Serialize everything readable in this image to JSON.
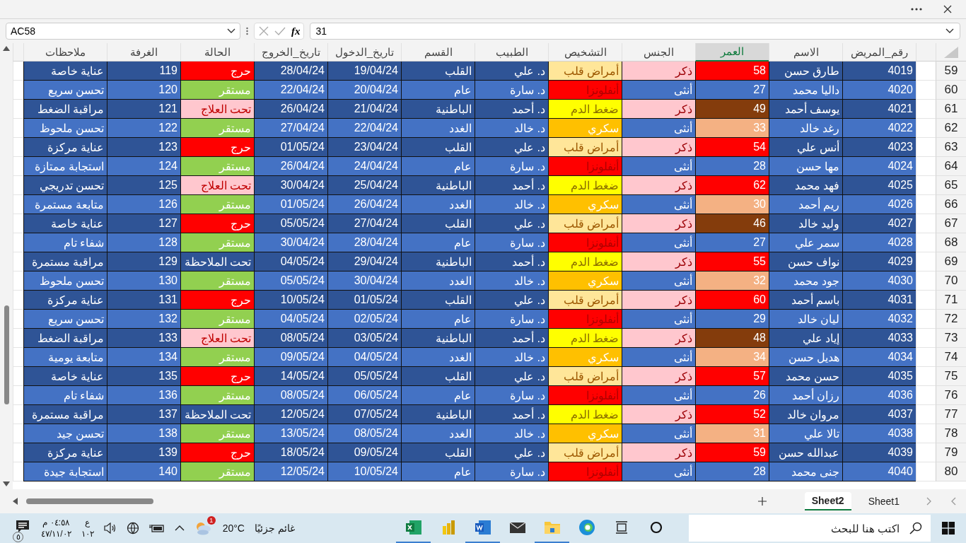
{
  "formula_bar": {
    "name_box": "AC58",
    "function_label": "fx",
    "formula": "31"
  },
  "sheet": {
    "columns": [
      {
        "label": "رقم_المريض",
        "selected": false
      },
      {
        "label": "الاسم",
        "selected": false
      },
      {
        "label": "العمر",
        "selected": true
      },
      {
        "label": "الجنس",
        "selected": false
      },
      {
        "label": "التشخيص",
        "selected": false
      },
      {
        "label": "الطبيب",
        "selected": false
      },
      {
        "label": "القسم",
        "selected": false
      },
      {
        "label": "تاريخ_الدخول",
        "selected": false
      },
      {
        "label": "تاريخ_الخروج",
        "selected": false
      },
      {
        "label": "الحالة",
        "selected": false
      },
      {
        "label": "الغرفة",
        "selected": false
      },
      {
        "label": "ملاحظات",
        "selected": false
      }
    ],
    "rows": [
      {
        "row": "59",
        "cells": [
          "4019",
          "طارق حسن",
          {
            "text": "58",
            "kind": "red"
          },
          {
            "text": "ذكر",
            "kind": "male"
          },
          {
            "text": "أمراض قلب",
            "kind": "heart"
          },
          "د. علي",
          "القلب",
          "19/04/24",
          "28/04/24",
          {
            "text": "حرج",
            "kind": "critical"
          },
          "119",
          "عناية خاصة"
        ]
      },
      {
        "row": "60",
        "cells": [
          "4020",
          "داليا محمد",
          {
            "text": "27",
            "kind": "plain"
          },
          {
            "text": "أنثى",
            "kind": "female"
          },
          {
            "text": "أنفلونزا",
            "kind": "flu"
          },
          "د. سارة",
          "عام",
          "20/04/24",
          "22/04/24",
          {
            "text": "مستقر",
            "kind": "stable"
          },
          "120",
          "تحسن سريع"
        ]
      },
      {
        "row": "61",
        "cells": [
          "4021",
          "يوسف أحمد",
          {
            "text": "49",
            "kind": "brown"
          },
          {
            "text": "ذكر",
            "kind": "male"
          },
          {
            "text": "ضغط الدم",
            "kind": "pressure"
          },
          "د. أحمد",
          "الباطنية",
          "21/04/24",
          "26/04/24",
          {
            "text": "تحت العلاج",
            "kind": "treatment"
          },
          "121",
          "مراقبة الضغط"
        ]
      },
      {
        "row": "62",
        "cells": [
          "4022",
          "رغد خالد",
          {
            "text": "33",
            "kind": "salmon"
          },
          {
            "text": "أنثى",
            "kind": "female"
          },
          {
            "text": "سكري",
            "kind": "diabetes"
          },
          "د. خالد",
          "الغدد",
          "22/04/24",
          "27/04/24",
          {
            "text": "مستقر",
            "kind": "stable"
          },
          "122",
          "تحسن ملحوظ"
        ]
      },
      {
        "row": "63",
        "cells": [
          "4023",
          "أنس علي",
          {
            "text": "54",
            "kind": "red"
          },
          {
            "text": "ذكر",
            "kind": "male"
          },
          {
            "text": "أمراض قلب",
            "kind": "heart"
          },
          "د. علي",
          "القلب",
          "23/04/24",
          "01/05/24",
          {
            "text": "حرج",
            "kind": "critical"
          },
          "123",
          "عناية مركزة"
        ]
      },
      {
        "row": "64",
        "cells": [
          "4024",
          "مها حسن",
          {
            "text": "28",
            "kind": "plain"
          },
          {
            "text": "أنثى",
            "kind": "female"
          },
          {
            "text": "أنفلونزا",
            "kind": "flu"
          },
          "د. سارة",
          "عام",
          "24/04/24",
          "26/04/24",
          {
            "text": "مستقر",
            "kind": "stable"
          },
          "124",
          "استجابة ممتازة"
        ]
      },
      {
        "row": "65",
        "cells": [
          "4025",
          "فهد محمد",
          {
            "text": "62",
            "kind": "red"
          },
          {
            "text": "ذكر",
            "kind": "male"
          },
          {
            "text": "ضغط الدم",
            "kind": "pressure"
          },
          "د. أحمد",
          "الباطنية",
          "25/04/24",
          "30/04/24",
          {
            "text": "تحت العلاج",
            "kind": "treatment"
          },
          "125",
          "تحسن تدريجي"
        ]
      },
      {
        "row": "66",
        "cells": [
          "4026",
          "ريم أحمد",
          {
            "text": "30",
            "kind": "salmon"
          },
          {
            "text": "أنثى",
            "kind": "female"
          },
          {
            "text": "سكري",
            "kind": "diabetes"
          },
          "د. خالد",
          "الغدد",
          "26/04/24",
          "01/05/24",
          {
            "text": "مستقر",
            "kind": "stable"
          },
          "126",
          "متابعة مستمرة"
        ]
      },
      {
        "row": "67",
        "cells": [
          "4027",
          "وليد خالد",
          {
            "text": "46",
            "kind": "brown"
          },
          {
            "text": "ذكر",
            "kind": "male"
          },
          {
            "text": "أمراض قلب",
            "kind": "heart"
          },
          "د. علي",
          "القلب",
          "27/04/24",
          "05/05/24",
          {
            "text": "حرج",
            "kind": "critical"
          },
          "127",
          "عناية خاصة"
        ]
      },
      {
        "row": "68",
        "cells": [
          "4028",
          "سمر علي",
          {
            "text": "27",
            "kind": "plain"
          },
          {
            "text": "أنثى",
            "kind": "female"
          },
          {
            "text": "أنفلونزا",
            "kind": "flu"
          },
          "د. سارة",
          "عام",
          "28/04/24",
          "30/04/24",
          {
            "text": "مستقر",
            "kind": "stable"
          },
          "128",
          "شفاء تام"
        ]
      },
      {
        "row": "69",
        "cells": [
          "4029",
          "نواف حسن",
          {
            "text": "55",
            "kind": "red"
          },
          {
            "text": "ذكر",
            "kind": "male"
          },
          {
            "text": "ضغط الدم",
            "kind": "pressure"
          },
          "د. أحمد",
          "الباطنية",
          "29/04/24",
          "04/05/24",
          {
            "text": "تحت الملاحظة",
            "kind": "observation"
          },
          "129",
          "مراقبة مستمرة"
        ]
      },
      {
        "row": "70",
        "cells": [
          "4030",
          "جود محمد",
          {
            "text": "32",
            "kind": "salmon"
          },
          {
            "text": "أنثى",
            "kind": "female"
          },
          {
            "text": "سكري",
            "kind": "diabetes"
          },
          "د. خالد",
          "الغدد",
          "30/04/24",
          "05/05/24",
          {
            "text": "مستقر",
            "kind": "stable"
          },
          "130",
          "تحسن ملحوظ"
        ]
      },
      {
        "row": "71",
        "cells": [
          "4031",
          "باسم أحمد",
          {
            "text": "60",
            "kind": "red"
          },
          {
            "text": "ذكر",
            "kind": "male"
          },
          {
            "text": "أمراض قلب",
            "kind": "heart"
          },
          "د. علي",
          "القلب",
          "01/05/24",
          "10/05/24",
          {
            "text": "حرج",
            "kind": "critical"
          },
          "131",
          "عناية مركزة"
        ]
      },
      {
        "row": "72",
        "cells": [
          "4032",
          "ليان خالد",
          {
            "text": "29",
            "kind": "plain"
          },
          {
            "text": "أنثى",
            "kind": "female"
          },
          {
            "text": "أنفلونزا",
            "kind": "flu"
          },
          "د. سارة",
          "عام",
          "02/05/24",
          "04/05/24",
          {
            "text": "مستقر",
            "kind": "stable"
          },
          "132",
          "تحسن سريع"
        ]
      },
      {
        "row": "73",
        "cells": [
          "4033",
          "إياد علي",
          {
            "text": "48",
            "kind": "brown"
          },
          {
            "text": "ذكر",
            "kind": "male"
          },
          {
            "text": "ضغط الدم",
            "kind": "pressure"
          },
          "د. أحمد",
          "الباطنية",
          "03/05/24",
          "08/05/24",
          {
            "text": "تحت العلاج",
            "kind": "treatment"
          },
          "133",
          "مراقبة الضغط"
        ]
      },
      {
        "row": "74",
        "cells": [
          "4034",
          "هديل حسن",
          {
            "text": "34",
            "kind": "salmon"
          },
          {
            "text": "أنثى",
            "kind": "female"
          },
          {
            "text": "سكري",
            "kind": "diabetes"
          },
          "د. خالد",
          "الغدد",
          "04/05/24",
          "09/05/24",
          {
            "text": "مستقر",
            "kind": "stable"
          },
          "134",
          "متابعة يومية"
        ]
      },
      {
        "row": "75",
        "cells": [
          "4035",
          "حسن محمد",
          {
            "text": "57",
            "kind": "red"
          },
          {
            "text": "ذكر",
            "kind": "male"
          },
          {
            "text": "أمراض قلب",
            "kind": "heart"
          },
          "د. علي",
          "القلب",
          "05/05/24",
          "14/05/24",
          {
            "text": "حرج",
            "kind": "critical"
          },
          "135",
          "عناية خاصة"
        ]
      },
      {
        "row": "76",
        "cells": [
          "4036",
          "رزان أحمد",
          {
            "text": "26",
            "kind": "plain"
          },
          {
            "text": "أنثى",
            "kind": "female"
          },
          {
            "text": "أنفلونزا",
            "kind": "flu"
          },
          "د. سارة",
          "عام",
          "06/05/24",
          "08/05/24",
          {
            "text": "مستقر",
            "kind": "stable"
          },
          "136",
          "شفاء تام"
        ]
      },
      {
        "row": "77",
        "cells": [
          "4037",
          "مروان خالد",
          {
            "text": "52",
            "kind": "red"
          },
          {
            "text": "ذكر",
            "kind": "male"
          },
          {
            "text": "ضغط الدم",
            "kind": "pressure"
          },
          "د. أحمد",
          "الباطنية",
          "07/05/24",
          "12/05/24",
          {
            "text": "تحت الملاحظة",
            "kind": "observation"
          },
          "137",
          "مراقبة مستمرة"
        ]
      },
      {
        "row": "78",
        "cells": [
          "4038",
          "تالا علي",
          {
            "text": "31",
            "kind": "salmon"
          },
          {
            "text": "أنثى",
            "kind": "female"
          },
          {
            "text": "سكري",
            "kind": "diabetes"
          },
          "د. خالد",
          "الغدد",
          "08/05/24",
          "13/05/24",
          {
            "text": "مستقر",
            "kind": "stable"
          },
          "138",
          "تحسن جيد"
        ]
      },
      {
        "row": "79",
        "cells": [
          "4039",
          "عبدالله حسن",
          {
            "text": "59",
            "kind": "red"
          },
          {
            "text": "ذكر",
            "kind": "male"
          },
          {
            "text": "أمراض قلب",
            "kind": "heart"
          },
          "د. علي",
          "القلب",
          "09/05/24",
          "18/05/24",
          {
            "text": "حرج",
            "kind": "critical"
          },
          "139",
          "عناية مركزة"
        ]
      },
      {
        "row": "80",
        "cells": [
          "4040",
          "جنى محمد",
          {
            "text": "28",
            "kind": "plain"
          },
          {
            "text": "أنثى",
            "kind": "female"
          },
          {
            "text": "أنفلونزا",
            "kind": "flu"
          },
          "د. سارة",
          "عام",
          "10/05/24",
          "12/05/24",
          {
            "text": "مستقر",
            "kind": "stable"
          },
          "140",
          "استجابة جيدة"
        ]
      }
    ]
  },
  "sheet_tabs": [
    {
      "label": "Sheet1",
      "selected": false
    },
    {
      "label": "Sheet2",
      "selected": true
    }
  ],
  "taskbar": {
    "notification_count": "٥",
    "time": "٠٤:٥٨ م",
    "date": "٤٧/١١/٠٢",
    "language": "ع",
    "language_sub": "١٠٢",
    "weather_badge": "1",
    "temperature": "20°C",
    "weather": "غائم جزئيًا",
    "apps": [
      {
        "kind": "excel",
        "open": true
      },
      {
        "kind": "powerbi",
        "open": false
      },
      {
        "kind": "word",
        "open": true
      },
      {
        "kind": "mail",
        "open": false
      },
      {
        "kind": "explorer",
        "open": true
      },
      {
        "kind": "edge",
        "open": false
      },
      {
        "kind": "taskview",
        "open": false
      },
      {
        "kind": "cortana",
        "open": false
      }
    ],
    "search_placeholder": "اكتب هنا للبحث"
  }
}
